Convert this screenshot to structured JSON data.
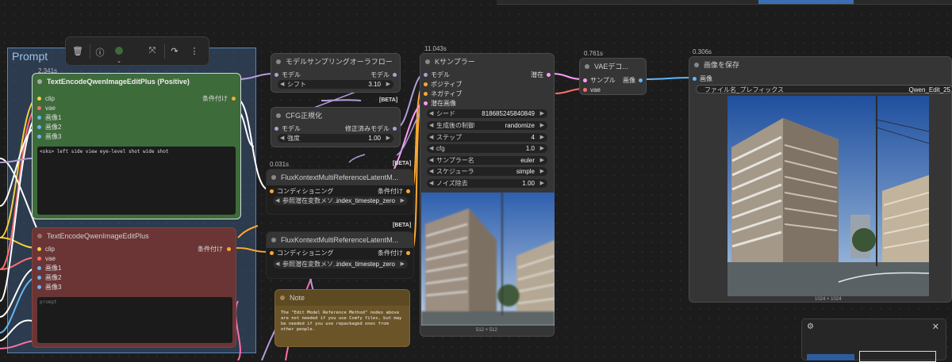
{
  "group": {
    "title": "Prompt"
  },
  "toolbar": {
    "icons": [
      "trash-icon",
      "info-icon",
      "color-icon",
      "fit-icon",
      "redo-icon",
      "more-icon"
    ]
  },
  "nodes": {
    "pos": {
      "timing": "2.341s",
      "title": "TextEncodeQwenImageEditPlus (Positive)",
      "inputs": [
        "clip",
        "vae",
        "画像1",
        "画像2",
        "画像3"
      ],
      "output": "条件付け",
      "prompt": "<sks> left side view eye-level shot wide shot"
    },
    "neg": {
      "title": "TextEncodeQwenImageEditPlus",
      "inputs": [
        "clip",
        "vae",
        "画像1",
        "画像2",
        "画像3"
      ],
      "output": "条件付け",
      "placeholder": "prompt"
    },
    "aura": {
      "title": "モデルサンプリングオーラフロー",
      "in": "モデル",
      "out": "モデル",
      "widget_label": "シフト",
      "widget_value": "3.10"
    },
    "cfgnorm": {
      "title": "CFG正規化",
      "in": "モデル",
      "out": "修正済みモデル",
      "widget_label": "強度",
      "widget_value": "1.00",
      "beta": "[BETA]"
    },
    "flux1": {
      "timing": "0.031s",
      "title": "FluxKontextMultiReferenceLatentM...",
      "in": "コンディショニング",
      "out": "条件付け",
      "widget_label": "参照潜在変数メソ...",
      "widget_value": "index_timestep_zero",
      "beta": "[BETA]"
    },
    "flux2": {
      "title": "FluxKontextMultiReferenceLatentM...",
      "in": "コンディショニング",
      "out": "条件付け",
      "widget_label": "参照潜在変数メソ...",
      "widget_value": "index_timestep_zero",
      "beta": "[BETA]"
    },
    "note": {
      "title": "Note",
      "text": "The \"Edit Model Reference Method\" nodes above are not needed if you use Comfy files, but may be needed if you use repackaged ones from other people."
    },
    "ksampler": {
      "timing": "11.043s",
      "title": "Kサンプラー",
      "inputs": [
        "モデル",
        "ポジティブ",
        "ネガティブ",
        "潜在画像"
      ],
      "output": "潜在",
      "widgets": [
        {
          "label": "シード",
          "value": "818685245840849"
        },
        {
          "label": "生成後の制御",
          "value": "randomize"
        },
        {
          "label": "ステップ",
          "value": "4"
        },
        {
          "label": "cfg",
          "value": "1.0"
        },
        {
          "label": "サンプラー名",
          "value": "euler"
        },
        {
          "label": "スケジューラ",
          "value": "simple"
        },
        {
          "label": "ノイズ除去",
          "value": "1.00"
        }
      ],
      "preview_size": "512 × 512"
    },
    "vae": {
      "timing": "0.761s",
      "title": "VAEデコ...",
      "inputs": [
        "サンプル",
        "vae"
      ],
      "output": "画像"
    },
    "save": {
      "timing": "0.306s",
      "title": "画像を保存",
      "in": "画像",
      "widget_label": "ファイル名_プレフィックス",
      "widget_value": "Qwen_Edit_25",
      "preview_size": "1024 × 1024"
    }
  },
  "minimap": {
    "icons": [
      "settings-icon",
      "close-icon"
    ]
  },
  "colors": {
    "clip": "#f4d03f",
    "vae": "#ff6e6e",
    "image": "#64b5f6",
    "conditioning": "#ffa931",
    "model": "#b39ddb",
    "latent": "#ff9cf9",
    "pos_node": "#3e6b3a",
    "neg_node": "#6b3535",
    "note_node": "#6b5528"
  }
}
